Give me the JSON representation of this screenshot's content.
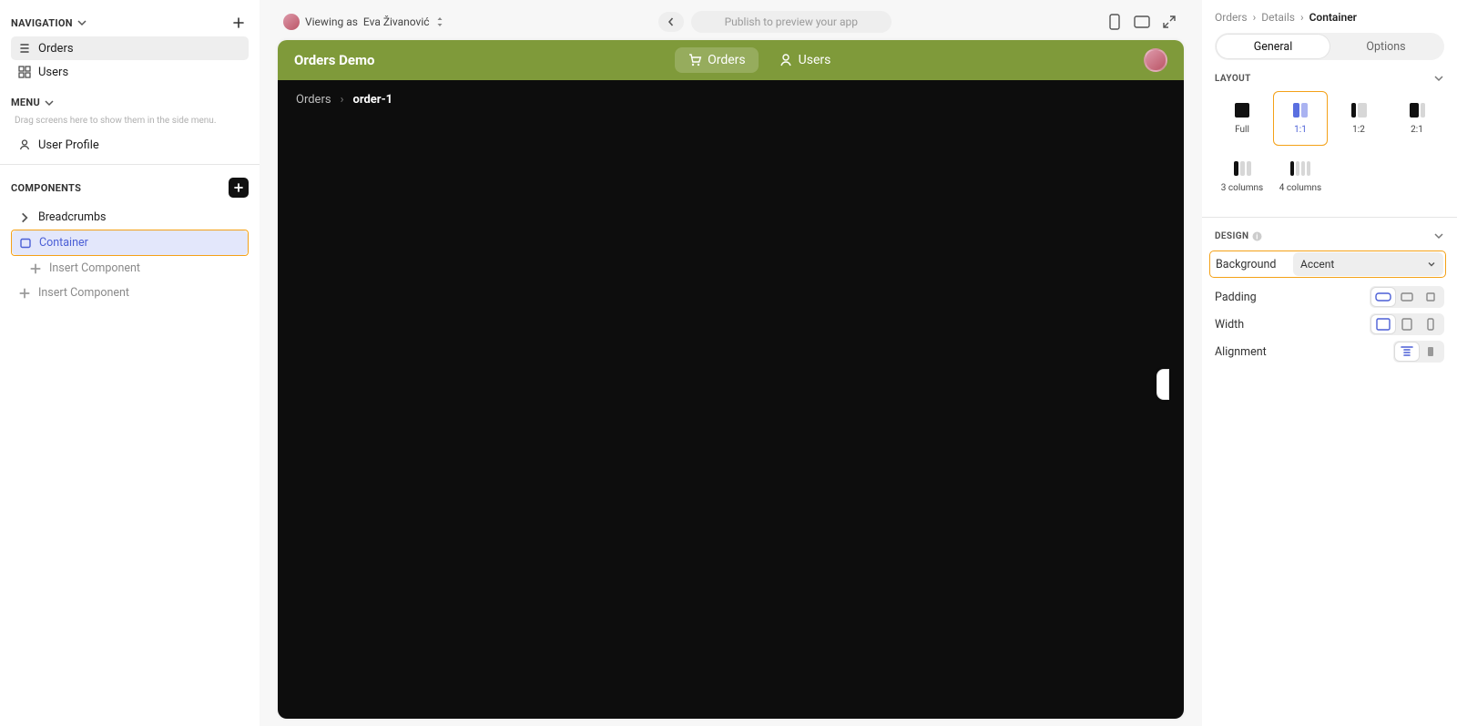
{
  "left": {
    "navigation_label": "NAVIGATION",
    "menu_label": "MENU",
    "components_label": "COMPONENTS",
    "nav_items": [
      {
        "label": "Orders",
        "icon": "list"
      },
      {
        "label": "Users",
        "icon": "grid"
      }
    ],
    "menu_hint": "Drag screens here to show them in the side menu.",
    "menu_items": [
      {
        "label": "User Profile",
        "icon": "user"
      }
    ],
    "tree": [
      {
        "label": "Breadcrumbs",
        "type": "node"
      },
      {
        "label": "Container",
        "type": "selected"
      },
      {
        "label": "Insert Component",
        "type": "insert"
      },
      {
        "label": "Insert Component",
        "type": "insert"
      }
    ]
  },
  "center": {
    "viewer_prefix": "Viewing as",
    "viewer_name": "Eva Živanović",
    "publish_text": "Publish to preview your app",
    "brand": "Orders Demo",
    "nav": [
      {
        "label": "Orders",
        "active": true
      },
      {
        "label": "Users",
        "active": false
      }
    ],
    "crumb_root": "Orders",
    "crumb_leaf": "order-1"
  },
  "right": {
    "breadcrumb": [
      "Orders",
      "Details",
      "Container"
    ],
    "tab_general": "General",
    "tab_options": "Options",
    "layout_label": "LAYOUT",
    "layout_opts": [
      "Full",
      "1:1",
      "1:2",
      "2:1",
      "3 columns",
      "4 columns"
    ],
    "design_label": "DESIGN",
    "background_label": "Background",
    "background_value": "Accent",
    "padding_label": "Padding",
    "width_label": "Width",
    "alignment_label": "Alignment"
  }
}
